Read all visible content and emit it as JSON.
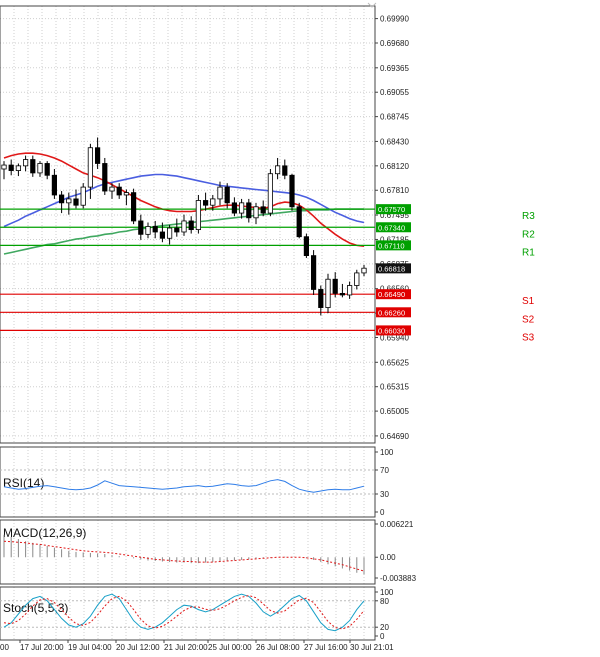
{
  "chart_data": [
    {
      "type": "candlestick",
      "title": "",
      "ylim": [
        0.646,
        0.7015
      ],
      "price_ticks": [
        "0.69990",
        "0.69680",
        "0.69365",
        "0.69055",
        "0.68745",
        "0.68430",
        "0.68120",
        "0.67810",
        "0.67495",
        "0.67185",
        "0.66875",
        "0.66560",
        "0.66250",
        "0.65940",
        "0.65625",
        "0.65315",
        "0.65005",
        "0.64690"
      ],
      "x_labels": [
        "17 Jul 20:00",
        "19 Jul 04:00",
        "20 Jul 12:00",
        "21 Jul 20:00",
        "25 Jul 00:00",
        "26 Jul 08:00",
        "27 Jul 16:00",
        "30 Jul 21:01"
      ],
      "x_label_partial": "00",
      "candles": [
        {
          "o": 0.6808,
          "h": 0.6818,
          "l": 0.6795,
          "c": 0.6813
        },
        {
          "o": 0.6813,
          "h": 0.682,
          "l": 0.68,
          "c": 0.6806
        },
        {
          "o": 0.6806,
          "h": 0.6815,
          "l": 0.6799,
          "c": 0.6812
        },
        {
          "o": 0.6812,
          "h": 0.6825,
          "l": 0.6805,
          "c": 0.682
        },
        {
          "o": 0.682,
          "h": 0.6825,
          "l": 0.6798,
          "c": 0.6803
        },
        {
          "o": 0.6803,
          "h": 0.6818,
          "l": 0.6798,
          "c": 0.6815
        },
        {
          "o": 0.6815,
          "h": 0.6818,
          "l": 0.6795,
          "c": 0.68
        },
        {
          "o": 0.68,
          "h": 0.6808,
          "l": 0.677,
          "c": 0.6775
        },
        {
          "o": 0.6775,
          "h": 0.678,
          "l": 0.6752,
          "c": 0.6765
        },
        {
          "o": 0.6765,
          "h": 0.6778,
          "l": 0.675,
          "c": 0.677
        },
        {
          "o": 0.677,
          "h": 0.6782,
          "l": 0.6758,
          "c": 0.6762
        },
        {
          "o": 0.6762,
          "h": 0.679,
          "l": 0.6758,
          "c": 0.6785
        },
        {
          "o": 0.6785,
          "h": 0.684,
          "l": 0.677,
          "c": 0.6835
        },
        {
          "o": 0.6835,
          "h": 0.6848,
          "l": 0.6808,
          "c": 0.6815
        },
        {
          "o": 0.6815,
          "h": 0.6822,
          "l": 0.6775,
          "c": 0.678
        },
        {
          "o": 0.678,
          "h": 0.679,
          "l": 0.677,
          "c": 0.6785
        },
        {
          "o": 0.6785,
          "h": 0.679,
          "l": 0.677,
          "c": 0.6775
        },
        {
          "o": 0.6775,
          "h": 0.6782,
          "l": 0.6762,
          "c": 0.6778
        },
        {
          "o": 0.6778,
          "h": 0.6783,
          "l": 0.6738,
          "c": 0.6742
        },
        {
          "o": 0.6742,
          "h": 0.675,
          "l": 0.6718,
          "c": 0.6725
        },
        {
          "o": 0.6725,
          "h": 0.674,
          "l": 0.672,
          "c": 0.6735
        },
        {
          "o": 0.6735,
          "h": 0.6742,
          "l": 0.672,
          "c": 0.6728
        },
        {
          "o": 0.6728,
          "h": 0.674,
          "l": 0.6715,
          "c": 0.672
        },
        {
          "o": 0.672,
          "h": 0.6737,
          "l": 0.6712,
          "c": 0.6733
        },
        {
          "o": 0.6733,
          "h": 0.6745,
          "l": 0.6722,
          "c": 0.6728
        },
        {
          "o": 0.6728,
          "h": 0.675,
          "l": 0.6723,
          "c": 0.6742
        },
        {
          "o": 0.6742,
          "h": 0.6748,
          "l": 0.6726,
          "c": 0.6731
        },
        {
          "o": 0.6731,
          "h": 0.6775,
          "l": 0.6726,
          "c": 0.6768
        },
        {
          "o": 0.6768,
          "h": 0.6778,
          "l": 0.6755,
          "c": 0.6762
        },
        {
          "o": 0.6762,
          "h": 0.6775,
          "l": 0.6755,
          "c": 0.677
        },
        {
          "o": 0.677,
          "h": 0.6792,
          "l": 0.6762,
          "c": 0.6785
        },
        {
          "o": 0.6785,
          "h": 0.679,
          "l": 0.6758,
          "c": 0.6765
        },
        {
          "o": 0.6765,
          "h": 0.6772,
          "l": 0.6748,
          "c": 0.6752
        },
        {
          "o": 0.6752,
          "h": 0.677,
          "l": 0.6745,
          "c": 0.6765
        },
        {
          "o": 0.6765,
          "h": 0.677,
          "l": 0.674,
          "c": 0.6746
        },
        {
          "o": 0.6746,
          "h": 0.6765,
          "l": 0.6738,
          "c": 0.676
        },
        {
          "o": 0.676,
          "h": 0.6768,
          "l": 0.6748,
          "c": 0.6752
        },
        {
          "o": 0.6752,
          "h": 0.6808,
          "l": 0.6748,
          "c": 0.6802
        },
        {
          "o": 0.6802,
          "h": 0.6822,
          "l": 0.6795,
          "c": 0.6812
        },
        {
          "o": 0.6812,
          "h": 0.682,
          "l": 0.6795,
          "c": 0.68
        },
        {
          "o": 0.68,
          "h": 0.6802,
          "l": 0.6755,
          "c": 0.676
        },
        {
          "o": 0.676,
          "h": 0.6765,
          "l": 0.672,
          "c": 0.6722
        },
        {
          "o": 0.6722,
          "h": 0.6726,
          "l": 0.6695,
          "c": 0.6698
        },
        {
          "o": 0.6698,
          "h": 0.6705,
          "l": 0.6648,
          "c": 0.6655
        },
        {
          "o": 0.6655,
          "h": 0.666,
          "l": 0.6622,
          "c": 0.6632
        },
        {
          "o": 0.6632,
          "h": 0.6675,
          "l": 0.6625,
          "c": 0.6668
        },
        {
          "o": 0.6668,
          "h": 0.6677,
          "l": 0.6645,
          "c": 0.665
        },
        {
          "o": 0.665,
          "h": 0.6662,
          "l": 0.6645,
          "c": 0.6648
        },
        {
          "o": 0.6648,
          "h": 0.6665,
          "l": 0.6643,
          "c": 0.666
        },
        {
          "o": 0.666,
          "h": 0.668,
          "l": 0.6655,
          "c": 0.6676
        },
        {
          "o": 0.6676,
          "h": 0.6686,
          "l": 0.6672,
          "c": 0.6682
        }
      ],
      "ma_red": [
        0.6822,
        0.6825,
        0.6827,
        0.6828,
        0.6828,
        0.6827,
        0.6825,
        0.6822,
        0.6818,
        0.6813,
        0.6808,
        0.6803,
        0.68,
        0.6797,
        0.6793,
        0.6788,
        0.6783,
        0.6778,
        0.6773,
        0.6768,
        0.6764,
        0.676,
        0.6757,
        0.6755,
        0.6754,
        0.6754,
        0.6754,
        0.6755,
        0.6757,
        0.6759,
        0.6761,
        0.6762,
        0.6762,
        0.6761,
        0.676,
        0.6759,
        0.6758,
        0.676,
        0.6764,
        0.6766,
        0.6765,
        0.6762,
        0.6756,
        0.6748,
        0.6739,
        0.6732,
        0.6725,
        0.6719,
        0.6714,
        0.6711,
        0.671
      ],
      "ma_blue": [
        0.6735,
        0.6739,
        0.6743,
        0.6748,
        0.6752,
        0.6756,
        0.676,
        0.6764,
        0.6768,
        0.6772,
        0.6775,
        0.6778,
        0.6782,
        0.6786,
        0.6789,
        0.6791,
        0.6793,
        0.6795,
        0.6797,
        0.6799,
        0.68,
        0.6801,
        0.6801,
        0.68,
        0.6799,
        0.6797,
        0.6795,
        0.6793,
        0.6791,
        0.6789,
        0.6787,
        0.6786,
        0.6785,
        0.6784,
        0.6783,
        0.6782,
        0.6781,
        0.678,
        0.6779,
        0.6778,
        0.6777,
        0.6775,
        0.6772,
        0.6768,
        0.6763,
        0.6758,
        0.6753,
        0.6749,
        0.6745,
        0.6742,
        0.674
      ],
      "ma_green": [
        0.67,
        0.6702,
        0.6704,
        0.6706,
        0.6708,
        0.671,
        0.6712,
        0.6713,
        0.6715,
        0.6717,
        0.6719,
        0.672,
        0.6722,
        0.6723,
        0.6725,
        0.6726,
        0.6728,
        0.6729,
        0.6731,
        0.6732,
        0.6733,
        0.6735,
        0.6736,
        0.6737,
        0.6738,
        0.6739,
        0.674,
        0.6741,
        0.6742,
        0.6743,
        0.6744,
        0.6745,
        0.6746,
        0.6747,
        0.6748,
        0.6749,
        0.675,
        0.6751,
        0.6752,
        0.6753,
        0.6754,
        0.6755,
        0.6755,
        0.6756,
        0.6756,
        0.6756,
        0.6757,
        0.6757,
        0.6757,
        0.6757,
        0.6757
      ],
      "levels": [
        {
          "name": "R3",
          "value": 0.6757,
          "label": "0.67570",
          "color": "#00a000",
          "tag": "#00a000"
        },
        {
          "name": "R2",
          "value": 0.6734,
          "label": "0.67340",
          "color": "#00a000",
          "tag": "#00a000"
        },
        {
          "name": "R1",
          "value": 0.6711,
          "label": "0.67110",
          "color": "#00a000",
          "tag": "#00a000"
        },
        {
          "name": "S1",
          "value": 0.6649,
          "label": "0.66490",
          "color": "#e00000",
          "tag": "#e00000"
        },
        {
          "name": "S2",
          "value": 0.6626,
          "label": "0.66260",
          "color": "#e00000",
          "tag": "#e00000"
        },
        {
          "name": "S3",
          "value": 0.6603,
          "label": "0.66030",
          "color": "#e00000",
          "tag": "#e00000"
        }
      ],
      "current_price": {
        "value": 0.66818,
        "label": "0.66818"
      }
    },
    {
      "type": "line",
      "title": "RSI(14)",
      "ylim": [
        0,
        100
      ],
      "ticks": [
        "100",
        "70",
        "30",
        "0"
      ],
      "tick_values": [
        100,
        70,
        30,
        0
      ],
      "values": [
        42,
        40,
        38,
        39,
        41,
        43,
        44,
        42,
        40,
        38,
        37,
        38,
        40,
        45,
        52,
        48,
        44,
        43,
        42,
        41,
        40,
        39,
        38,
        39,
        40,
        42,
        43,
        44,
        42,
        43,
        45,
        47,
        46,
        44,
        43,
        44,
        48,
        52,
        54,
        51,
        44,
        38,
        35,
        33,
        35,
        37,
        38,
        37,
        37,
        40,
        43
      ]
    },
    {
      "type": "bar",
      "title": "MACD(12,26,9)",
      "ylim": [
        -0.003883,
        0.006221
      ],
      "ticks": [
        "0.006221",
        "0.00",
        "-0.003883"
      ],
      "tick_values": [
        0.006221,
        0.0,
        -0.003883
      ],
      "histogram": [
        0.0042,
        0.0038,
        0.0034,
        0.003,
        0.0027,
        0.0024,
        0.0021,
        0.0018,
        0.0015,
        0.0012,
        0.001,
        0.0009,
        0.0008,
        0.0007,
        0.0006,
        0.0004,
        0.0002,
        0.0,
        -0.0002,
        -0.0004,
        -0.0006,
        -0.0007,
        -0.0008,
        -0.0009,
        -0.001,
        -0.001,
        -0.0011,
        -0.0011,
        -0.001,
        -0.0009,
        -0.0008,
        -0.0007,
        -0.0006,
        -0.0005,
        -0.0004,
        -0.0003,
        -0.0002,
        -0.0001,
        0.0,
        0.0001,
        0.0001,
        0.0,
        -0.0002,
        -0.0005,
        -0.0009,
        -0.0013,
        -0.0017,
        -0.0021,
        -0.0025,
        -0.0029,
        -0.0032
      ],
      "signal": [
        0.003,
        0.0029,
        0.0028,
        0.0027,
        0.0025,
        0.0024,
        0.0022,
        0.002,
        0.0018,
        0.0016,
        0.0014,
        0.0012,
        0.0011,
        0.001,
        0.0009,
        0.0008,
        0.0006,
        0.0004,
        0.0002,
        0.0,
        -0.0002,
        -0.0004,
        -0.0005,
        -0.0006,
        -0.0007,
        -0.0008,
        -0.0008,
        -0.0009,
        -0.0009,
        -0.0009,
        -0.0008,
        -0.0007,
        -0.0006,
        -0.0005,
        -0.0004,
        -0.0003,
        -0.0002,
        -0.0001,
        0.0,
        0.0,
        0.0,
        0.0,
        -0.0001,
        -0.0003,
        -0.0005,
        -0.0008,
        -0.0011,
        -0.0014,
        -0.0018,
        -0.0022,
        -0.0026
      ]
    },
    {
      "type": "line",
      "title": "Stoch(5,5,3)",
      "ylim": [
        0,
        100
      ],
      "ticks": [
        "100",
        "80",
        "20",
        "0"
      ],
      "tick_values": [
        100,
        80,
        20,
        0
      ],
      "k": [
        20,
        30,
        50,
        70,
        85,
        90,
        80,
        60,
        40,
        25,
        20,
        28,
        45,
        70,
        90,
        95,
        85,
        60,
        35,
        20,
        15,
        20,
        30,
        45,
        60,
        70,
        68,
        60,
        55,
        60,
        70,
        80,
        90,
        95,
        90,
        75,
        55,
        45,
        55,
        70,
        85,
        92,
        80,
        55,
        30,
        15,
        12,
        20,
        35,
        60,
        80
      ],
      "d": [
        30,
        28,
        35,
        50,
        68,
        82,
        85,
        76,
        60,
        42,
        28,
        24,
        31,
        48,
        68,
        85,
        90,
        80,
        60,
        38,
        23,
        18,
        22,
        32,
        45,
        58,
        66,
        66,
        61,
        58,
        62,
        70,
        80,
        88,
        92,
        87,
        73,
        58,
        52,
        57,
        70,
        82,
        86,
        76,
        55,
        33,
        19,
        16,
        22,
        38,
        58
      ]
    }
  ]
}
